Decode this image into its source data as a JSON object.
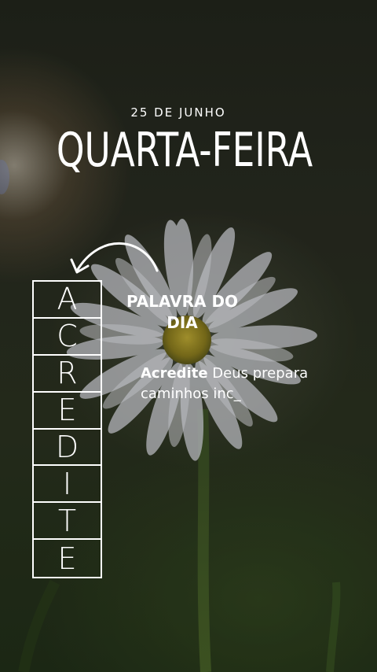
{
  "header": {
    "date": "25 DE JUNHO",
    "weekday": "QUARTA-FEIRA"
  },
  "word_column": {
    "letters": [
      "A",
      "C",
      "R",
      "E",
      "D",
      "I",
      "T",
      "E"
    ]
  },
  "word_of_day": {
    "heading_line1": "PALAVRA DO",
    "heading_line2": "DIA",
    "word": "Acredite",
    "message": " Deus prepara caminhos inc_"
  },
  "icons": {
    "arrow": "curved-arrow-icon",
    "arrow_color": "#ffffff"
  },
  "colors": {
    "text": "#ffffff",
    "petal": "#d9dbe2",
    "flower_center": "#b8a22c",
    "background": "#23271d"
  }
}
